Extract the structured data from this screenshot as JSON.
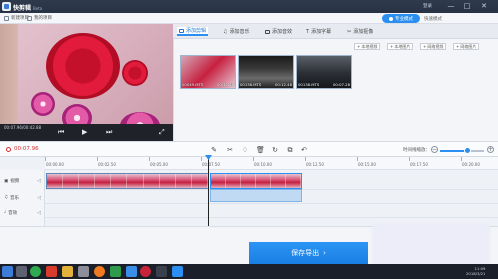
{
  "app": {
    "title": "快剪辑",
    "badge": "Beta",
    "login": "登录",
    "window_controls": [
      "—",
      "□",
      "✕"
    ]
  },
  "toolbar": {
    "new_project": "新建项目",
    "my_projects": "我的项目",
    "mode_active": "专业模式",
    "mode_other": "快速模式"
  },
  "preview": {
    "time": "00:07.96/00:42.88"
  },
  "media_tabs": [
    {
      "label": "添加剪辑",
      "icon": "film-icon",
      "active": true
    },
    {
      "label": "添加音乐",
      "icon": "music-icon",
      "active": false
    },
    {
      "label": "添加音效",
      "icon": "sound-icon",
      "active": false
    },
    {
      "label": "添加字幕",
      "icon": "text-icon",
      "active": false
    },
    {
      "label": "添加抠像",
      "icon": "cutout-icon",
      "active": false
    }
  ],
  "media_actions": [
    "本地视频",
    "本地图片",
    "网络视频",
    "网络图片"
  ],
  "clips": [
    {
      "name": "00049.MTS",
      "duration": "00:12.48"
    },
    {
      "name": "00138.MTS",
      "duration": "00:12.48"
    },
    {
      "name": "00138.MTS",
      "duration": "00:07.28"
    }
  ],
  "edit": {
    "current_time": "00:07.96",
    "zoom_label": "时间线缩放：",
    "zoom_minus": "−",
    "zoom_plus": "+"
  },
  "ruler": [
    "00:00.00",
    "00:02.50",
    "00:05.00",
    "00:07.50",
    "00:10.00",
    "00:12.50",
    "00:15.00",
    "00:17.50",
    "00:20.00"
  ],
  "tracks": [
    {
      "label": "视频",
      "icon": "video-track-icon"
    },
    {
      "label": "音乐",
      "icon": "music-track-icon"
    },
    {
      "label": "音效",
      "icon": "sound-track-icon"
    }
  ],
  "save_button": "保存导出",
  "tray": {
    "time": "11:09",
    "date": "2018/3/21"
  },
  "colors": {
    "accent": "#2a8ff0",
    "titlebar": "#2f3b4d",
    "timecode": "#d62f2f",
    "taskbar": "#1a1f29"
  }
}
